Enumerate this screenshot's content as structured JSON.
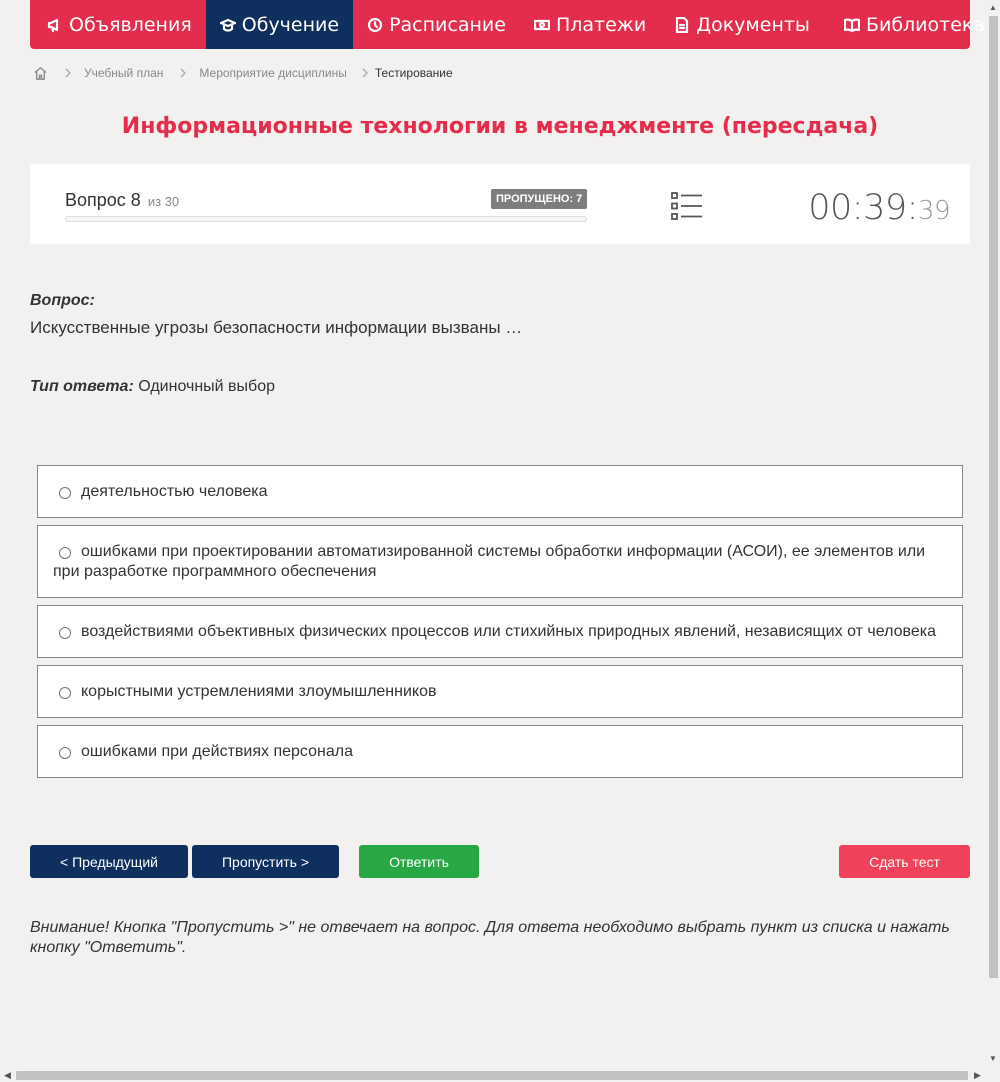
{
  "nav": {
    "items": [
      {
        "label": "Объявления",
        "icon": "megaphone-icon"
      },
      {
        "label": "Обучение",
        "icon": "graduation-cap-icon",
        "active": true
      },
      {
        "label": "Расписание",
        "icon": "clock-icon"
      },
      {
        "label": "Платежи",
        "icon": "money-icon"
      },
      {
        "label": "Документы",
        "icon": "document-icon"
      },
      {
        "label": "Библиотека",
        "icon": "book-icon"
      }
    ]
  },
  "breadcrumb": {
    "items": [
      "Учебный план",
      "Мероприятие дисциплины",
      "Тестирование"
    ]
  },
  "title": "Информационные технологии в менеджменте (пересдача)",
  "progress": {
    "question_label": "Вопрос 8",
    "of_label": "из 30",
    "skipped": "ПРОПУЩЕНО: 7",
    "fraction": 0
  },
  "timer": {
    "main": "00:39:",
    "seconds": "39"
  },
  "question": {
    "label": "Вопрос:",
    "text": "Искусственные угрозы безопасности информации вызваны …",
    "type_label": "Тип ответа:",
    "type_value": "Одиночный выбор"
  },
  "options": [
    "деятельностью человека",
    "ошибками при проектировании автоматизированной системы обработки информации (АСОИ), ее элементов или при разработке программного обеспечения",
    "воздействиями объективных физических процессов или стихийных природных явлений, независящих от человека",
    "корыстными устремлениями злоумышленников",
    "ошибками при действиях персонала"
  ],
  "buttons": {
    "prev": "< Предыдущий",
    "skip": "Пропустить >",
    "answer": "Ответить",
    "submit": "Сдать тест"
  },
  "warning": "Внимание! Кнопка \"Пропустить >\" не отвечает на вопрос. Для ответа необходимо выбрать пункт из списка и нажать кнопку \"Ответить\".",
  "colors": {
    "brand": "#e42c4c",
    "navy": "#0f2f5e",
    "green": "#28a745",
    "submit": "#f0435b"
  }
}
